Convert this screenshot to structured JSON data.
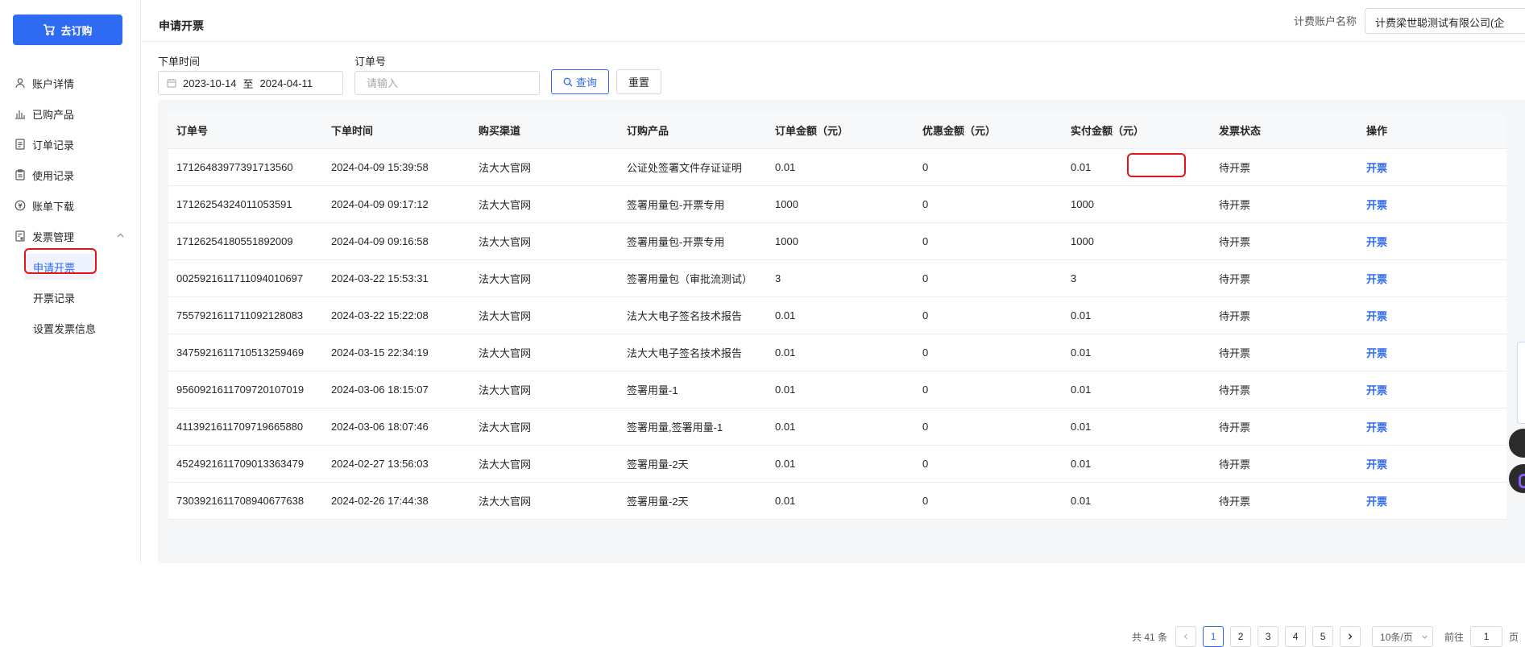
{
  "sidebar": {
    "cta_label": "去订购",
    "items": [
      {
        "label": "账户详情"
      },
      {
        "label": "已购产品"
      },
      {
        "label": "订单记录"
      },
      {
        "label": "使用记录"
      },
      {
        "label": "账单下载"
      },
      {
        "label": "发票管理"
      }
    ],
    "sub_items": [
      {
        "label": "申请开票",
        "active": true
      },
      {
        "label": "开票记录"
      },
      {
        "label": "设置发票信息"
      }
    ]
  },
  "header": {
    "title": "申请开票",
    "account_label": "计费账户名称",
    "account_value": "计费梁世聪测试有限公司(企"
  },
  "filters": {
    "date_label": "下单时间",
    "date_start": "2023-10-14",
    "date_sep": "至",
    "date_end": "2024-04-11",
    "order_label": "订单号",
    "order_placeholder": "请输入",
    "query_label": "查询",
    "reset_label": "重置"
  },
  "table": {
    "columns": [
      "订单号",
      "下单时间",
      "购买渠道",
      "订购产品",
      "订单金额（元）",
      "优惠金额（元）",
      "实付金额（元）",
      "发票状态",
      "操作"
    ],
    "rows": [
      [
        "17126483977391713560",
        "2024-04-09 15:39:58",
        "法大大官网",
        "公证处签署文件存证证明",
        "0.01",
        "0",
        "0.01",
        "待开票",
        "开票"
      ],
      [
        "17126254324011053591",
        "2024-04-09 09:17:12",
        "法大大官网",
        "签署用量包-开票专用",
        "1000",
        "0",
        "1000",
        "待开票",
        "开票"
      ],
      [
        "17126254180551892009",
        "2024-04-09 09:16:58",
        "法大大官网",
        "签署用量包-开票专用",
        "1000",
        "0",
        "1000",
        "待开票",
        "开票"
      ],
      [
        "00259216117110940106​97",
        "2024-03-22 15:53:31",
        "法大大官网",
        "签署用量包（审批流测试）",
        "3",
        "0",
        "3",
        "待开票",
        "开票"
      ],
      [
        "75579216117110921280​83",
        "2024-03-22 15:22:08",
        "法大大官网",
        "法大大电子签名技术报告",
        "0.01",
        "0",
        "0.01",
        "待开票",
        "开票"
      ],
      [
        "34759216117105132594​69",
        "2024-03-15 22:34:19",
        "法大大官网",
        "法大大电子签名技术报告",
        "0.01",
        "0",
        "0.01",
        "待开票",
        "开票"
      ],
      [
        "95609216117097201070​19",
        "2024-03-06 18:15:07",
        "法大大官网",
        "签署用量-1",
        "0.01",
        "0",
        "0.01",
        "待开票",
        "开票"
      ],
      [
        "41139216117097196658​80",
        "2024-03-06 18:07:46",
        "法大大官网",
        "签署用量,签署用量-1",
        "0.01",
        "0",
        "0.01",
        "待开票",
        "开票"
      ],
      [
        "45249216117090133634​79",
        "2024-02-27 13:56:03",
        "法大大官网",
        "签署用量-2天",
        "0.01",
        "0",
        "0.01",
        "待开票",
        "开票"
      ],
      [
        "73039216117089406776​38",
        "2024-02-26 17:44:38",
        "法大大官网",
        "签署用量-2天",
        "0.01",
        "0",
        "0.01",
        "待开票",
        "开票"
      ]
    ]
  },
  "pagination": {
    "total_text": "共 41 条",
    "pages": [
      "1",
      "2",
      "3",
      "4",
      "5"
    ],
    "current_page": "1",
    "page_size": "10条/页",
    "jump_label": "前往",
    "jump_value": "1",
    "jump_suffix": "页"
  },
  "colors": {
    "accent": "#2f6bf2",
    "highlight_box": "#e5141a"
  }
}
